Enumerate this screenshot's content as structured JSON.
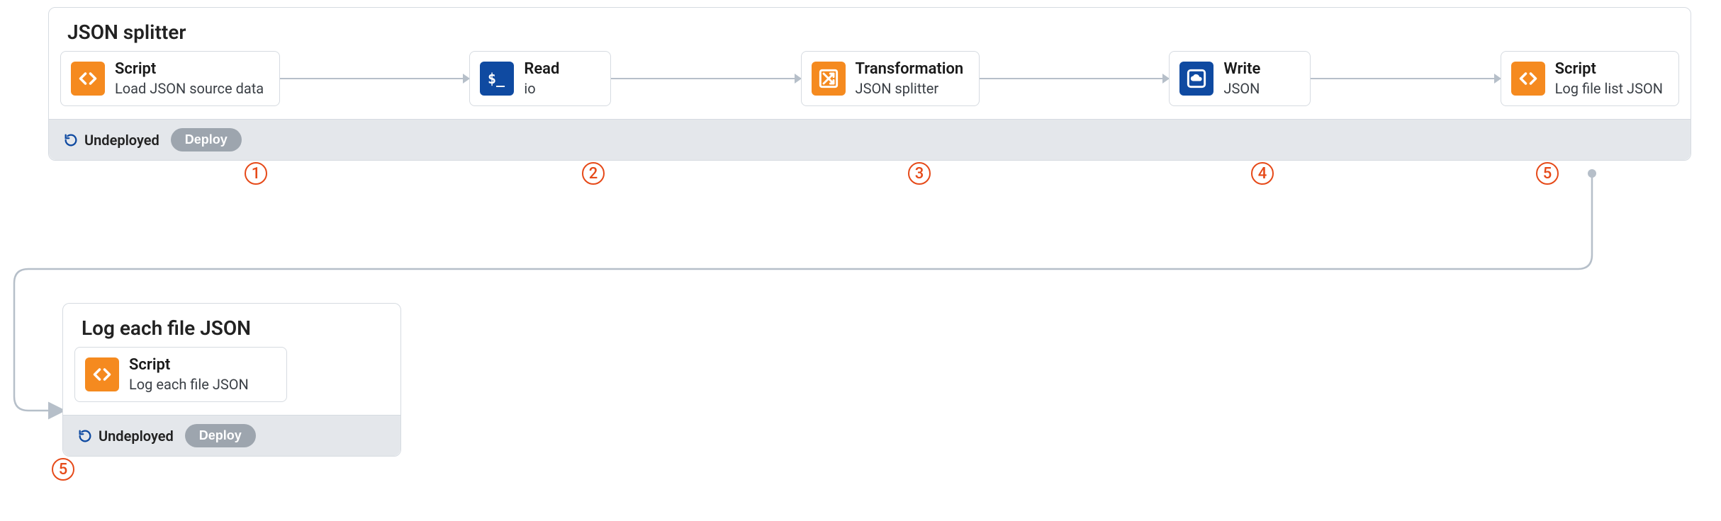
{
  "colors": {
    "orange": "#f58a1f",
    "blue": "#0f4aa1",
    "calloutRed": "#e64a19",
    "connector": "#b6bfc9"
  },
  "pipeline1": {
    "title": "JSON splitter",
    "status": "Undeployed",
    "deployLabel": "Deploy",
    "nodes": [
      {
        "iconColor": "orange",
        "iconName": "code-icon",
        "title": "Script",
        "subtitle": "Load JSON source data"
      },
      {
        "iconColor": "blue",
        "iconName": "terminal-icon",
        "title": "Read",
        "subtitle": "io"
      },
      {
        "iconColor": "orange",
        "iconName": "shuffle-icon",
        "title": "Transformation",
        "subtitle": "JSON splitter"
      },
      {
        "iconColor": "blue",
        "iconName": "cloud-icon",
        "title": "Write",
        "subtitle": "JSON"
      },
      {
        "iconColor": "orange",
        "iconName": "code-icon",
        "title": "Script",
        "subtitle": "Log file list JSON"
      }
    ],
    "callouts": [
      "1",
      "2",
      "3",
      "4",
      "5"
    ]
  },
  "pipeline2": {
    "title": "Log each file JSON",
    "status": "Undeployed",
    "deployLabel": "Deploy",
    "nodes": [
      {
        "iconColor": "orange",
        "iconName": "code-icon",
        "title": "Script",
        "subtitle": "Log each file JSON"
      }
    ],
    "callouts": [
      "5"
    ]
  }
}
